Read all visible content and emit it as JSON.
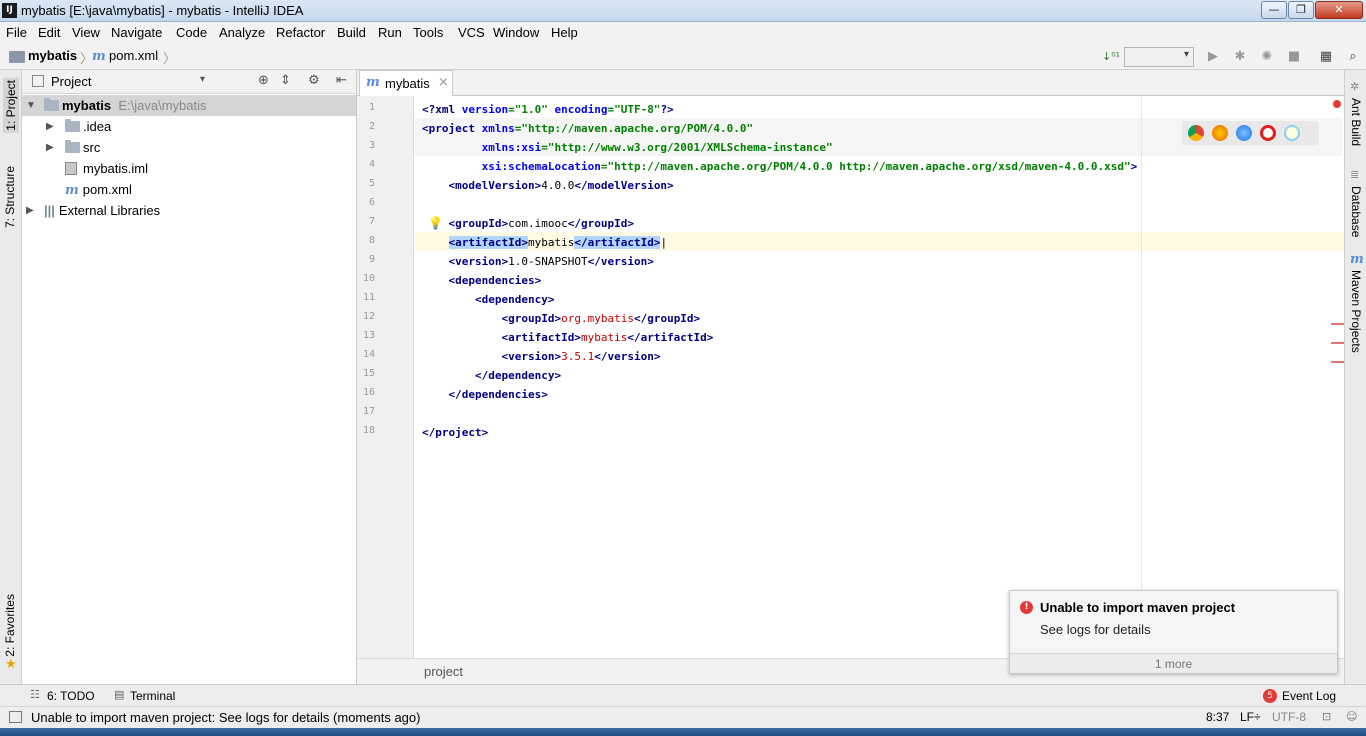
{
  "window": {
    "title": "mybatis [E:\\java\\mybatis] - mybatis - IntelliJ IDEA",
    "app_icon_text": "IJ",
    "minimize": "—",
    "maximize": "❐",
    "close": "✕"
  },
  "menu": [
    "File",
    "Edit",
    "View",
    "Navigate",
    "Code",
    "Analyze",
    "Refactor",
    "Build",
    "Run",
    "Tools",
    "VCS",
    "Window",
    "Help"
  ],
  "breadcrumb": {
    "project": "mybatis",
    "file": "pom.xml"
  },
  "left_strip": {
    "project_tab": "1: Project",
    "structure_tab": "7: Structure",
    "favorites_tab": "2: Favorites"
  },
  "project_panel": {
    "header": "Project",
    "root": {
      "name": "mybatis",
      "path": "E:\\java\\mybatis"
    },
    "items": [
      ".idea",
      "src",
      "mybatis.iml",
      "pom.xml"
    ],
    "external": "External Libraries"
  },
  "editor": {
    "tab": "mybatis",
    "tab_close": "×",
    "line_numbers": [
      "1",
      "2",
      "3",
      "4",
      "5",
      "6",
      "7",
      "8",
      "9",
      "10",
      "11",
      "12",
      "13",
      "14",
      "15",
      "16",
      "17",
      "18"
    ],
    "footer_breadcrumb": "project"
  },
  "right_strip": {
    "ant": "Ant Build",
    "database": "Database",
    "maven": "Maven Projects"
  },
  "bottom_tools": {
    "todo": "6: TODO",
    "terminal": "Terminal",
    "event_log": "Event Log",
    "event_count": "5"
  },
  "notification": {
    "title": "Unable to import maven project",
    "body": "See logs for details",
    "more": "1 more"
  },
  "status": {
    "message": "Unable to import maven project: See logs for details (moments ago)",
    "position": "8:37",
    "line_sep": "LF÷",
    "encoding": "UTF-8"
  },
  "colors": {
    "tag": "#000080",
    "attr": "#0000ff",
    "string": "#008000",
    "value": "#c00000",
    "error": "#e53935"
  }
}
